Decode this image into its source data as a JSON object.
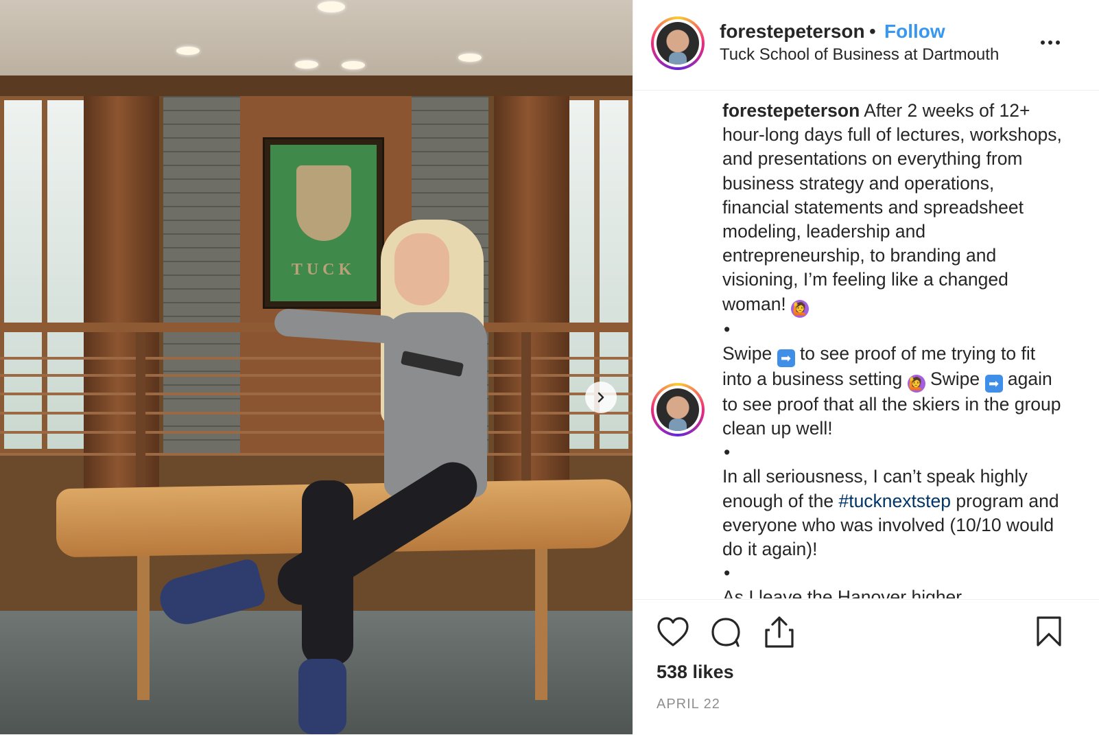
{
  "post": {
    "media": {
      "plaque_text": "TUCK",
      "next_icon": "chevron-right-icon"
    },
    "header": {
      "username": "forestepeterson",
      "separator": "•",
      "follow_label": "Follow",
      "location": "Tuck School of Business at Dartmouth",
      "more_icon": "more-horizontal-icon"
    },
    "caption": {
      "username": "forestepeterson",
      "p1": "After 2 weeks of 12+ hour-long days full of lectures, workshops, and presentations on everything from business strategy and operations, financial statements and spreadsheet modeling, leadership and entrepreneurship, to branding and visioning, I’m feeling like a changed woman!",
      "bullet": "•",
      "p2_a": "Swipe",
      "p2_b": "to see proof of me trying to fit into a business setting",
      "p2_c": "Swipe",
      "p2_d": "again to see proof that all the skiers in the group clean up well!",
      "p3_a": "In all seriousness, I can’t speak highly enough of the",
      "p3_hashtag": "#tucknextstep",
      "p3_b": "program and everyone who was involved (10/10 would do it again)!",
      "p4": "As I leave the Hanover higher",
      "emoji_arrow": "➡",
      "emoji_woman": "🙋"
    },
    "actions": {
      "like_icon": "heart-icon",
      "comment_icon": "comment-icon",
      "share_icon": "share-icon",
      "save_icon": "bookmark-icon"
    },
    "likes": "538 likes",
    "date": "APRIL 22"
  }
}
